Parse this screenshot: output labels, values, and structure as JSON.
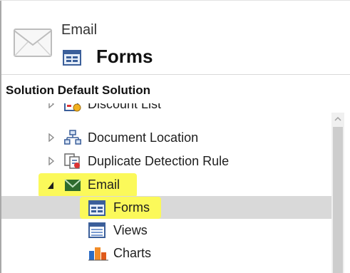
{
  "header": {
    "entity": "Email",
    "title": "Forms",
    "envelope_icon": "envelope-icon",
    "form_icon": "form-icon"
  },
  "solution": {
    "label": "Solution Default Solution"
  },
  "tree": {
    "items": [
      {
        "label": "Discount List",
        "icon": "discount-list-icon",
        "expander": "collapsed"
      },
      {
        "label": "Document Location",
        "icon": "document-location-icon",
        "expander": "collapsed"
      },
      {
        "label": "Duplicate Detection Rule",
        "icon": "duplicate-detection-icon",
        "expander": "collapsed"
      },
      {
        "label": "Email",
        "icon": "envelope-icon",
        "expander": "expanded",
        "highlighted": true
      },
      {
        "label": "Forms",
        "icon": "form-icon",
        "selected": true,
        "highlighted": true
      },
      {
        "label": "Views",
        "icon": "views-icon"
      },
      {
        "label": "Charts",
        "icon": "charts-icon"
      }
    ]
  },
  "colors": {
    "highlight": "#fbf95a",
    "selection": "#d9d9d9",
    "email_icon": "#2e6b2e",
    "charts_orange": "#f28c28",
    "charts_blue": "#2b6cc4"
  }
}
